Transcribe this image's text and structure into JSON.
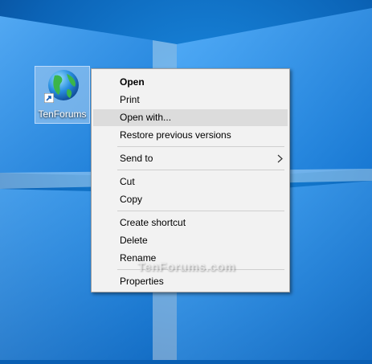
{
  "desktop": {
    "background_color": "#0a5fb3",
    "shortcut": {
      "label": "TenForums",
      "icon": "globe-icon",
      "overlay_icon": "shortcut-arrow-icon"
    }
  },
  "context_menu": {
    "items": [
      {
        "label": "Open",
        "bold": true
      },
      {
        "label": "Print"
      },
      {
        "label": "Open with...",
        "highlighted": true
      },
      {
        "label": "Restore previous versions"
      },
      {
        "label": "Send to",
        "submenu": true,
        "icon": "chevron-right-icon"
      },
      {
        "label": "Cut"
      },
      {
        "label": "Copy"
      },
      {
        "label": "Create shortcut"
      },
      {
        "label": "Delete"
      },
      {
        "label": "Rename"
      },
      {
        "label": "Properties"
      }
    ],
    "highlight_color": "#dcdcdc"
  },
  "watermark": {
    "text": "TenForums.com"
  }
}
